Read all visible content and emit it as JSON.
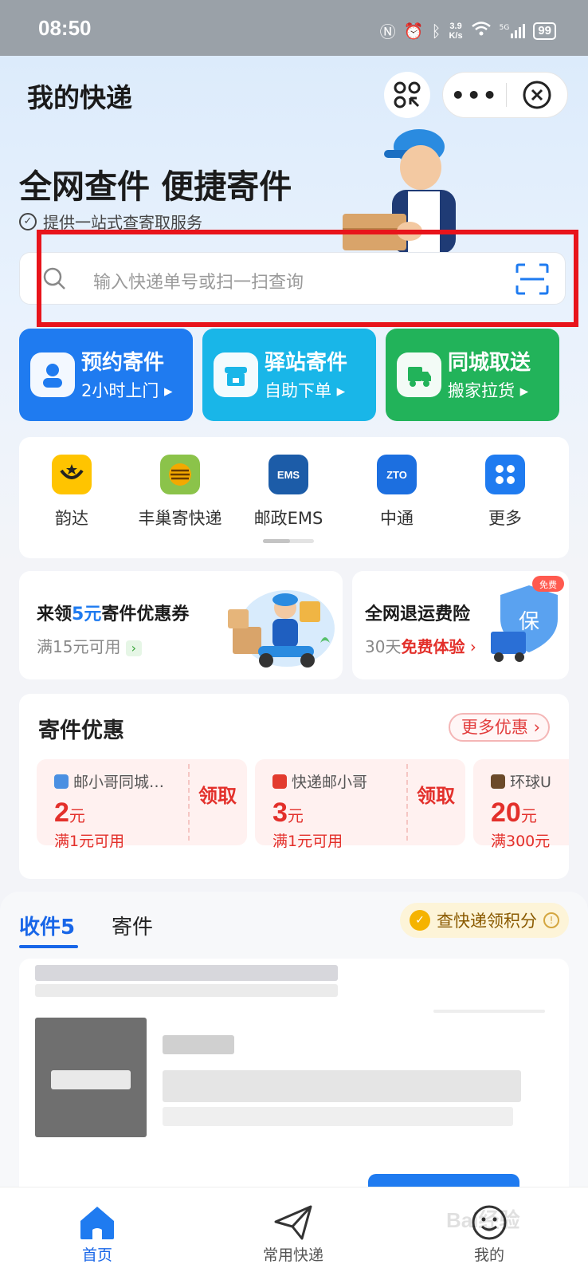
{
  "status_bar": {
    "time": "08:50",
    "speed_value": "3.9",
    "speed_unit": "K/s",
    "network": "5G",
    "battery": "99"
  },
  "header": {
    "title": "我的快递"
  },
  "hero": {
    "slogan": "全网查件 便捷寄件",
    "sub_slogan": "提供一站式查寄取服务"
  },
  "search": {
    "placeholder": "输入快递单号或扫一扫查询"
  },
  "services": [
    {
      "title": "预约寄件",
      "subtitle": "2小时上门 ▸",
      "color": "#1f7bf0"
    },
    {
      "title": "驿站寄件",
      "subtitle": "自助下单 ▸",
      "color": "#19b6e8"
    },
    {
      "title": "同城取送",
      "subtitle": "搬家拉货 ▸",
      "color": "#22b35a"
    }
  ],
  "carriers": [
    {
      "name": "韵达",
      "logo_text": "",
      "icon": "yunda-smile-icon"
    },
    {
      "name": "丰巢寄快递",
      "logo_text": "",
      "icon": "fengchao-icon"
    },
    {
      "name": "邮政EMS",
      "logo_text": "EMS",
      "icon": "ems-icon"
    },
    {
      "name": "中通",
      "logo_text": "ZTO",
      "icon": "zto-icon"
    },
    {
      "name": "更多",
      "logo_text": "",
      "icon": "grid-more-icon"
    }
  ],
  "promos": {
    "coupon": {
      "prefix": "来领",
      "amount": "5元",
      "suffix": "寄件优惠券",
      "condition": "满15元可用"
    },
    "insurance": {
      "title": "全网退运费险",
      "condition_prefix": "30天",
      "condition_highlight": "免费体验",
      "badge": "免费"
    }
  },
  "offers": {
    "heading": "寄件优惠",
    "more": "更多优惠 ›",
    "items": [
      {
        "name": "邮小哥同城…",
        "amount": "2",
        "unit": "元",
        "condition": "满1元可用",
        "action": "领取"
      },
      {
        "name": "快递邮小哥",
        "amount": "3",
        "unit": "元",
        "condition": "满1元可用",
        "action": "领取"
      },
      {
        "name": "环球U",
        "amount": "20",
        "unit": "元",
        "condition": "满300元",
        "action": ""
      }
    ]
  },
  "tabs": {
    "receive": "收件5",
    "send": "寄件",
    "points": "查快递领积分"
  },
  "tabbar": [
    {
      "label": "首页",
      "icon": "home-icon"
    },
    {
      "label": "常用快递",
      "icon": "paper-plane-icon"
    },
    {
      "label": "我的",
      "icon": "smile-face-icon"
    }
  ],
  "watermark": "Bai经验"
}
